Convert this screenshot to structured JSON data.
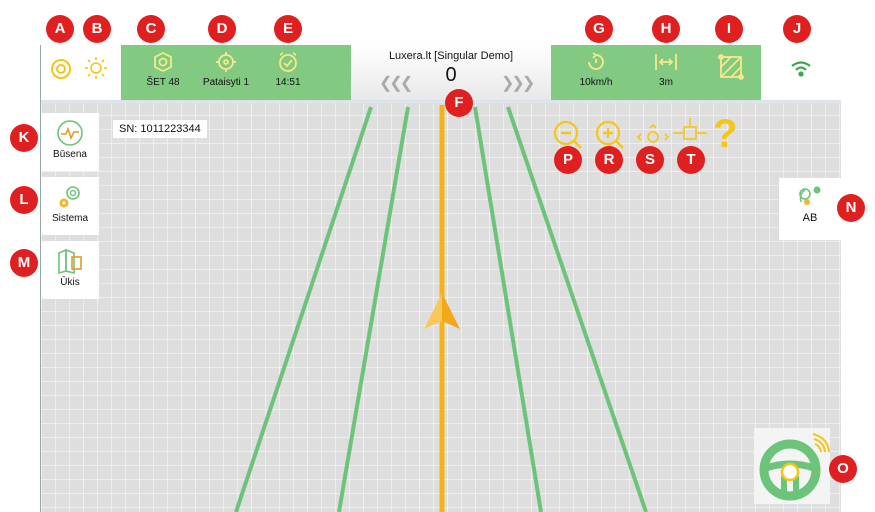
{
  "topbar": {
    "display_name": "Luxera.lt [Singular Demo]",
    "offset_value": "0",
    "items": {
      "set": "ŠET 48",
      "pass": "Pataisyti 1",
      "time": "14:51",
      "speed": "10km/h",
      "width": "3m"
    }
  },
  "serial": "SN: 1011223344",
  "side": {
    "status": "Būsena",
    "system": "Sistema",
    "farm": "Ūkis"
  },
  "ab_label": "AB",
  "tools": {
    "help": "?"
  },
  "badges": [
    "A",
    "B",
    "C",
    "D",
    "E",
    "F",
    "G",
    "H",
    "I",
    "J",
    "K",
    "L",
    "M",
    "N",
    "O",
    "P",
    "R",
    "S",
    "T"
  ],
  "colors": {
    "accent": "#f5c518",
    "green": "#82c982",
    "guide": "#f6b21a",
    "line": "#6cc47a",
    "badge": "#e02020"
  },
  "icons": [
    "sync-icon",
    "brightness-icon",
    "satellite-icon",
    "target-icon",
    "alarm-clock-icon",
    "speed-icon",
    "width-icon",
    "field-icon",
    "wifi-icon",
    "pulse-icon",
    "gear-icon",
    "map-icon",
    "ab-line-icon",
    "steering-wheel-icon",
    "zoom-out-icon",
    "zoom-in-icon",
    "pan-icon",
    "crosshair-icon",
    "help-icon",
    "vehicle-arrow-icon"
  ]
}
